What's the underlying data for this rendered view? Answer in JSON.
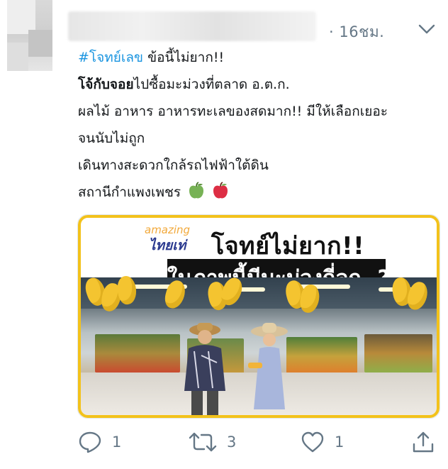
{
  "header": {
    "author_name": "",
    "timestamp": "· 16ชม.",
    "menu_icon": "chevron-down-icon"
  },
  "tweet": {
    "hashtag": "#โจทย์เลข",
    "line1_rest": " ข้อนี้ไม่ยาก!!",
    "line2_bold": "โจ้กับจอย",
    "line2_rest": "ไปซื้อมะม่วงที่ตลาด อ.ต.ก.",
    "line3": "ผลไม้ อาหาร อาหารทะเลของสดมาก!! มีให้เลือกเยอะ",
    "line4": "จนนับไม่ถูก",
    "line5": "เดินทางสะดวกใกล้รถไฟฟ้าใต้ดิน",
    "line6": "สถานีกำแพงเพชร",
    "emoji": [
      "green-apple-icon",
      "red-apple-icon"
    ]
  },
  "media": {
    "brand_top": "amazing",
    "brand_bottom": "ไทยเท่",
    "headline": "โจทย์ไม่ยาก!!",
    "caption": "ในภาพนี้มีมะม่วงกี่ลูก..?"
  },
  "actions": {
    "reply_count": "1",
    "retweet_count": "3",
    "like_count": "1"
  },
  "colors": {
    "hashtag": "#1b95e0",
    "muted": "#657786",
    "frame": "#f3c21b"
  }
}
